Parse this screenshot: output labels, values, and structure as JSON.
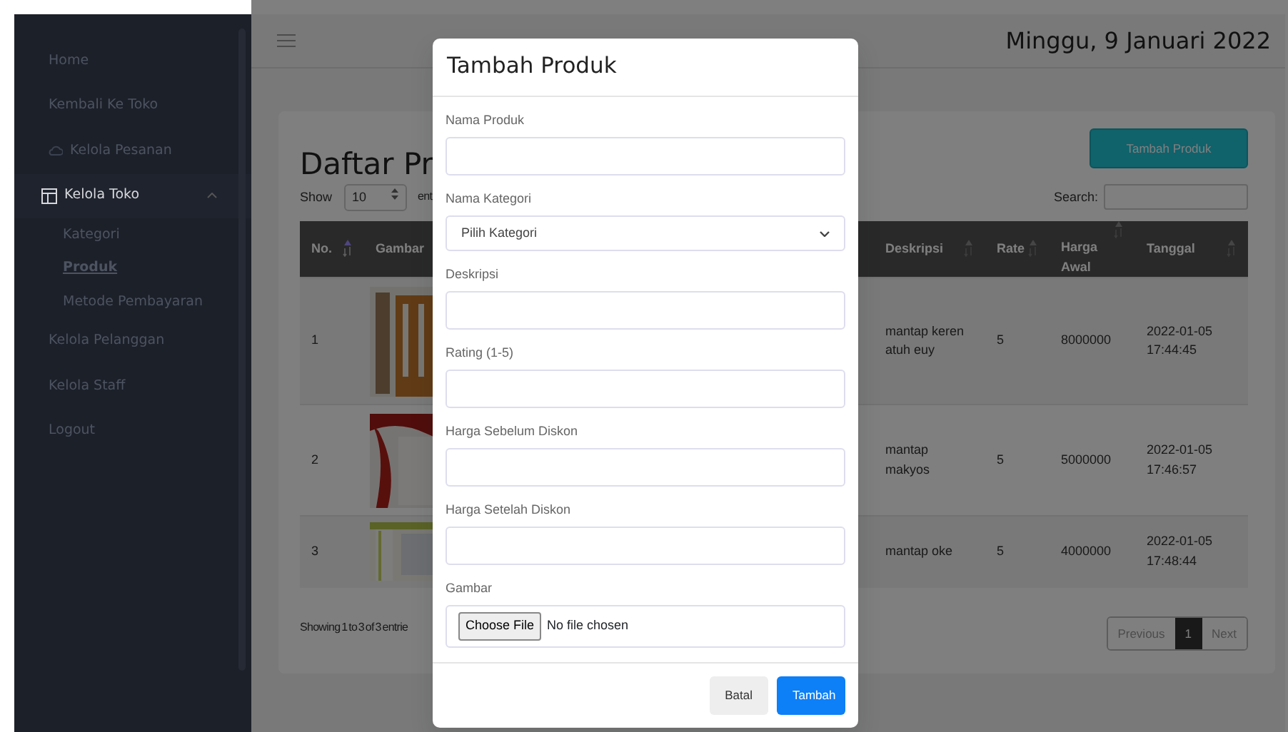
{
  "sidebar": {
    "items": [
      {
        "label": "Home",
        "kind": "link",
        "selected": false
      },
      {
        "label": "Kembali Ke Toko",
        "kind": "link",
        "selected": false
      },
      {
        "label": "Kelola Pesanan",
        "kind": "icon-link",
        "selected": false
      },
      {
        "label": "Kelola Toko",
        "kind": "group",
        "selected": true,
        "expanded": true,
        "children": [
          {
            "label": "Kategori",
            "selected": false
          },
          {
            "label": "Produk",
            "selected": true
          },
          {
            "label": "Metode Pembayaran",
            "selected": false
          }
        ]
      },
      {
        "label": "Kelola Pelanggan",
        "kind": "link",
        "selected": false
      },
      {
        "label": "Kelola Staff",
        "kind": "link",
        "selected": false
      },
      {
        "label": "Logout",
        "kind": "link",
        "selected": false
      }
    ]
  },
  "header": {
    "date": "Minggu, 9 Januari 2022"
  },
  "page": {
    "title": "Daftar Pr",
    "add_button": "Tambah Produk",
    "length": {
      "label": "Show",
      "value": "10",
      "suffix": "ent"
    },
    "search": {
      "label": "Search:"
    },
    "table": {
      "columns": [
        {
          "label": "No.",
          "kind": "text",
          "sortable": true,
          "sorted": true
        },
        {
          "label": "Gambar",
          "sortable": false
        },
        {
          "label": "Deskripsi",
          "kind": "text",
          "sortable": true,
          "sorted": false
        },
        {
          "label": "Rate",
          "kind": "text",
          "sortable": true,
          "sorted": false
        },
        {
          "label": "Harga Awal",
          "kind": "text",
          "sortable": true,
          "sorted": false
        },
        {
          "label": "Tanggal",
          "kind": "text",
          "sortable": true,
          "sorted": false
        }
      ],
      "rows": [
        {
          "cells": [
            "1",
            {
              "kind": "picture"
            },
            "mantap keren atuh euy",
            "5",
            "8000000",
            "2022-01-05 17:44:45"
          ]
        },
        {
          "cells": [
            "2",
            {
              "kind": "picture"
            },
            "mantap makyos",
            "5",
            "5000000",
            "2022-01-05 17:46:57"
          ]
        },
        {
          "cells": [
            "3",
            {
              "kind": "picture"
            },
            "mantap oke",
            "5",
            "4000000",
            "2022-01-05 17:48:44"
          ]
        }
      ]
    },
    "info": "Showing 1 to 3 of 3 entrie",
    "pagination": [
      {
        "label": "Previous",
        "selected": false
      },
      {
        "label": "1",
        "selected": true
      },
      {
        "label": "Next",
        "selected": false
      }
    ]
  },
  "modal": {
    "title": "Tambah Produk",
    "fields": [
      {
        "label": "Nama Produk",
        "kind": "text"
      },
      {
        "label": "Nama Kategori",
        "kind": "select",
        "value": "Pilih Kategori"
      },
      {
        "label": "Deskripsi",
        "kind": "text"
      },
      {
        "label": "Rating (1-5)",
        "kind": "text"
      },
      {
        "label": "Harga Sebelum Diskon",
        "kind": "text"
      },
      {
        "label": "Harga Setelah Diskon",
        "kind": "text"
      },
      {
        "label": "Gambar",
        "kind": "file",
        "button": "Choose File",
        "status": "No file chosen"
      }
    ],
    "buttons": [
      {
        "label": "Batal",
        "kind": "secondary"
      },
      {
        "label": "Tambah",
        "kind": "primary"
      }
    ]
  }
}
